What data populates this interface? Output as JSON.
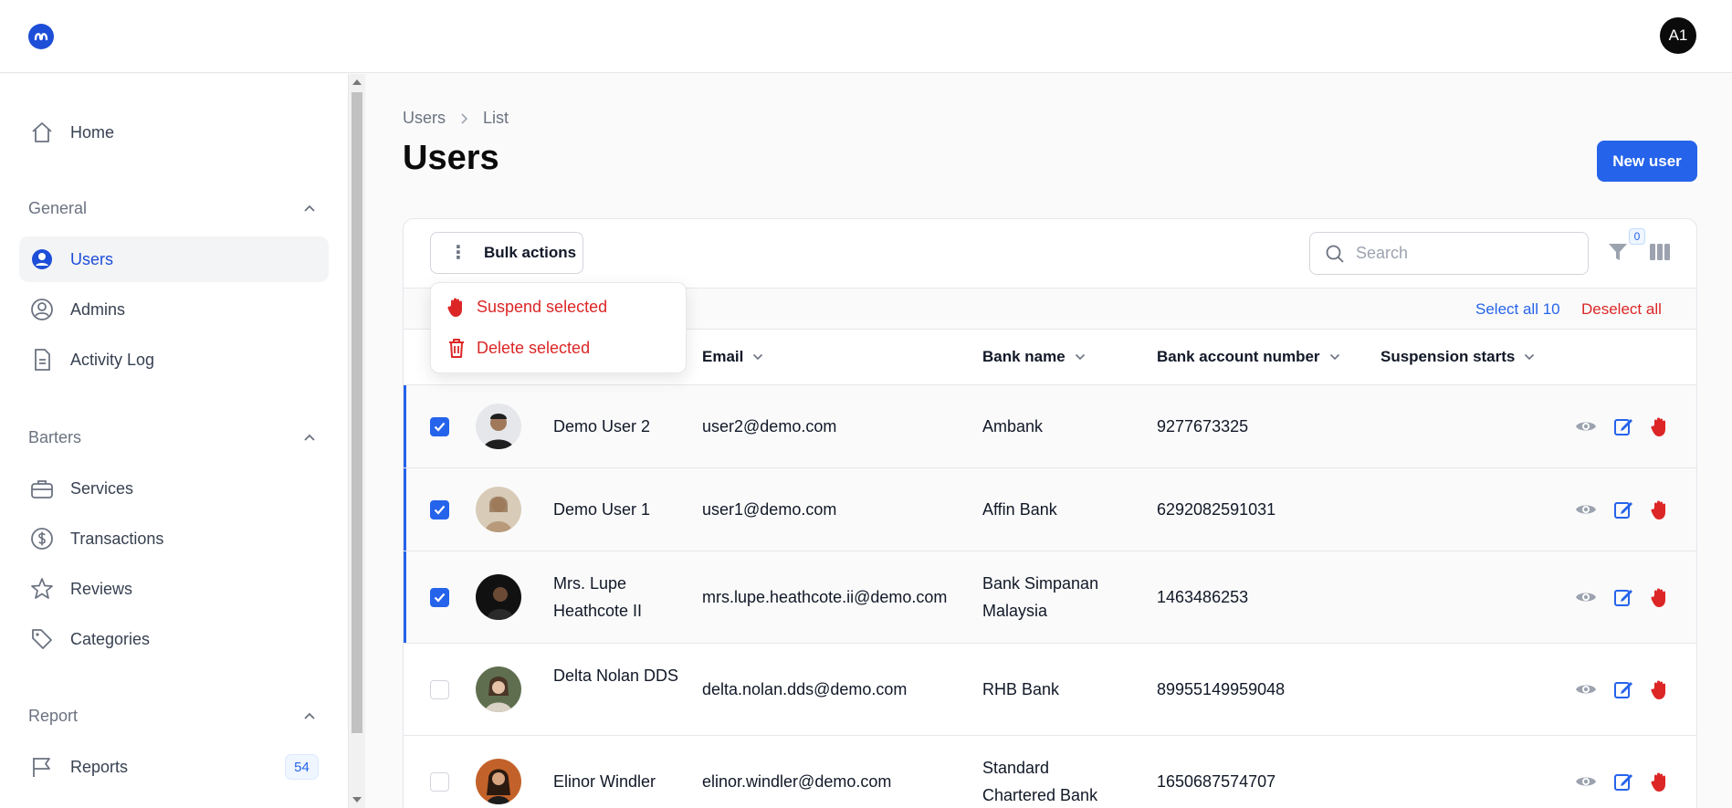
{
  "header": {
    "avatar_initials": "A1"
  },
  "sidebar": {
    "home": "Home",
    "groups": [
      {
        "label": "General",
        "items": [
          "Users",
          "Admins",
          "Activity Log"
        ]
      },
      {
        "label": "Barters",
        "items": [
          "Services",
          "Transactions",
          "Reviews",
          "Categories"
        ]
      },
      {
        "label": "Report",
        "items": [
          "Reports"
        ]
      }
    ],
    "reports_badge": "54",
    "active_item": "Users"
  },
  "breadcrumb": {
    "parent": "Users",
    "current": "List"
  },
  "page": {
    "title": "Users",
    "new_button": "New user"
  },
  "toolbar": {
    "bulk_actions": "Bulk actions",
    "search_placeholder": "Search",
    "filter_count": "0"
  },
  "bulk_menu": {
    "suspend": "Suspend selected",
    "delete": "Delete selected"
  },
  "selection": {
    "select_all": "Select all 10",
    "deselect_all": "Deselect all"
  },
  "columns": [
    "Email",
    "Bank name",
    "Bank account number",
    "Suspension starts"
  ],
  "rows": [
    {
      "name": "Demo User 2",
      "email": "user2@demo.com",
      "bank": "Ambank",
      "account": "9277673325",
      "selected": true
    },
    {
      "name": "Demo User 1",
      "email": "user1@demo.com",
      "bank": "Affin Bank",
      "account": "6292082591031",
      "selected": true
    },
    {
      "name": "Mrs. Lupe Heathcote II",
      "email": "mrs.lupe.heathcote.ii@demo.com",
      "bank": "Bank Simpanan Malaysia",
      "account": "1463486253",
      "selected": true
    },
    {
      "name": "Delta Nolan DDS",
      "email": "delta.nolan.dds@demo.com",
      "bank": "RHB Bank",
      "account": "89955149959048",
      "selected": false
    },
    {
      "name": "Elinor Windler",
      "email": "elinor.windler@demo.com",
      "bank": "Standard Chartered Bank",
      "account": "1650687574707",
      "selected": false
    }
  ],
  "colors": {
    "accent": "#2563eb",
    "danger": "#dc2626",
    "icon_gray": "#9ca3af"
  }
}
